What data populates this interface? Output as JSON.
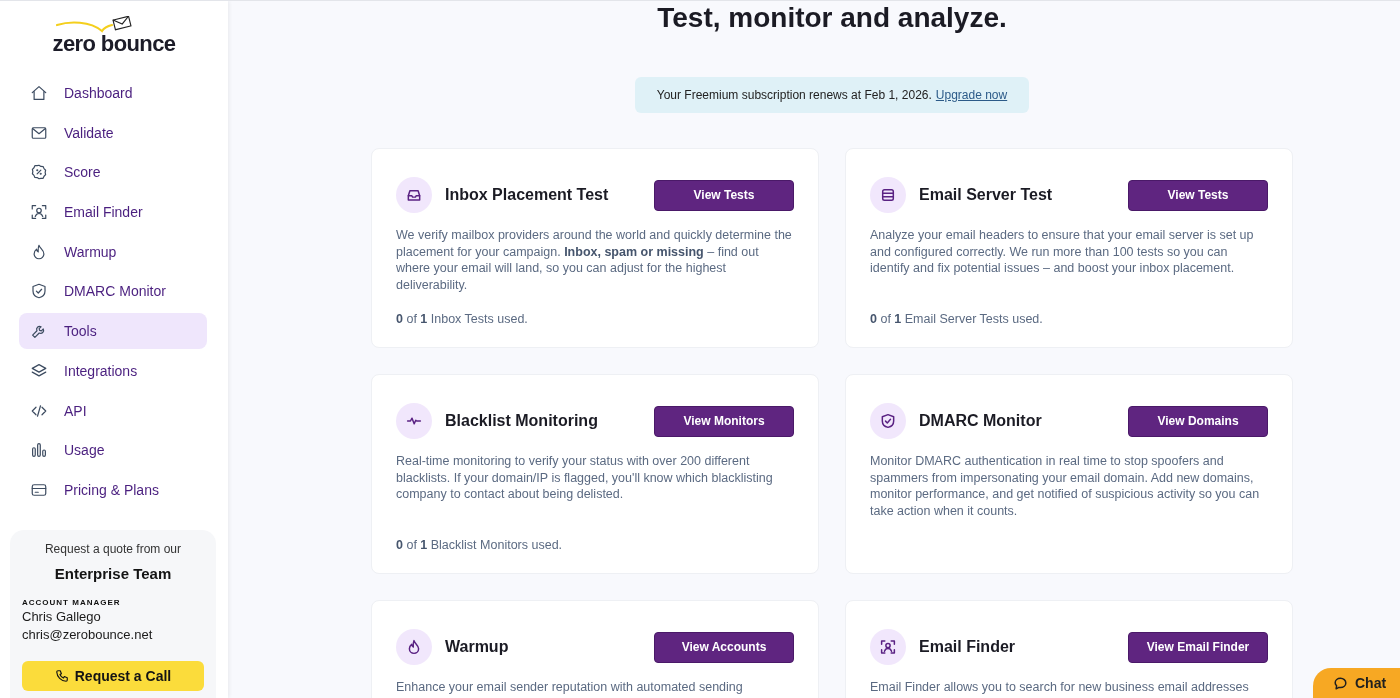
{
  "sidebar": {
    "logo": {
      "text": "zero bounce"
    },
    "items": [
      {
        "kind": "home",
        "label": "Dashboard",
        "selected": false
      },
      {
        "kind": "envelope",
        "label": "Validate",
        "selected": false
      },
      {
        "kind": "badge",
        "label": "Score",
        "selected": false
      },
      {
        "kind": "person",
        "label": "Email Finder",
        "selected": false
      },
      {
        "kind": "flame",
        "label": "Warmup",
        "selected": false
      },
      {
        "kind": "shield",
        "label": "DMARC Monitor",
        "selected": false
      },
      {
        "kind": "wrench",
        "label": "Tools",
        "selected": true
      },
      {
        "kind": "layers",
        "label": "Integrations",
        "selected": false
      },
      {
        "kind": "code",
        "label": "API",
        "selected": false
      },
      {
        "kind": "bars",
        "label": "Usage",
        "selected": false
      },
      {
        "kind": "card",
        "label": "Pricing & Plans",
        "selected": false
      }
    ],
    "enterprise_card": {
      "intro": "Request a quote from our",
      "title": "Enterprise Team",
      "role_label": "ACCOUNT MANAGER",
      "manager_name": "Chris Gallego",
      "manager_email": "chris@zerobounce.net",
      "button": "Request a Call"
    }
  },
  "main": {
    "title": "Test, monitor and analyze.",
    "banner": {
      "text": "Your Freemium subscription renews at Feb 1, 2026.",
      "link": "Upgrade now"
    },
    "tools": [
      {
        "kind": "inbox",
        "title": "Inbox Placement Test",
        "button": "View Tests",
        "description": "We verify mailbox providers around the world and quickly determine the placement for your campaign. **Inbox, spam or missing** – find out where your email will land, so you can adjust for the highest deliverability.",
        "usage": "**0** of **1** Inbox Tests used."
      },
      {
        "kind": "list",
        "title": "Email Server Test",
        "button": "View Tests",
        "description": "Analyze your email headers to ensure that your email server is set up and configured correctly. We run more than 100 tests so you can identify and fix potential issues – and boost your inbox placement.",
        "usage": "**0** of **1** Email Server Tests used."
      },
      {
        "kind": "pulse",
        "title": "Blacklist Monitoring",
        "button": "View Monitors",
        "description": "Real-time monitoring to verify your status with over 200 different blacklists. If your domain/IP is flagged, you'll know which blacklisting company to contact about being delisted.",
        "usage": "**0** of **1** Blacklist Monitors used."
      },
      {
        "kind": "shield",
        "title": "DMARC Monitor",
        "button": "View Domains",
        "description": "Monitor DMARC authentication in real time to stop spoofers and spammers from impersonating your email domain. Add new domains, monitor performance, and get notified of suspicious activity so you can take action when it counts."
      },
      {
        "kind": "flame",
        "title": "Warmup",
        "button": "View Accounts",
        "description": "Enhance your email sender reputation with automated sending"
      },
      {
        "kind": "person",
        "title": "Email Finder",
        "button": "View Email Finder",
        "description": "Email Finder allows you to search for new business email addresses"
      }
    ]
  },
  "chat_button": {
    "label": "Chat"
  }
}
